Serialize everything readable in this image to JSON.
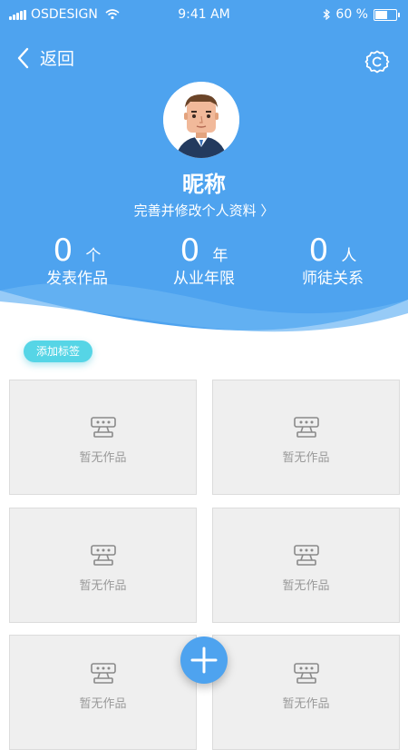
{
  "status_bar": {
    "carrier": "OSDESIGN",
    "time": "9:41 AM",
    "battery": "60 %",
    "battery_level": 0.6
  },
  "nav": {
    "back_label": "返回"
  },
  "profile": {
    "nickname": "昵称",
    "edit_link": "完善并修改个人资料 〉"
  },
  "stats": [
    {
      "value": "0",
      "unit": "个",
      "label": "发表作品"
    },
    {
      "value": "0",
      "unit": "年",
      "label": "从业年限"
    },
    {
      "value": "0",
      "unit": "人",
      "label": "师徒关系"
    }
  ],
  "tag_button": "添加标签",
  "works": [
    {
      "label": "暂无作品"
    },
    {
      "label": "暂无作品"
    },
    {
      "label": "暂无作品"
    },
    {
      "label": "暂无作品"
    },
    {
      "label": "暂无作品"
    },
    {
      "label": "暂无作品"
    }
  ],
  "colors": {
    "header": "#4ea3ef",
    "tag": "#56d5e6",
    "card": "#efefef"
  },
  "icons": [
    "signal-icon",
    "wifi-icon",
    "bluetooth-icon",
    "battery-icon",
    "back-icon",
    "settings-icon",
    "placeholder-icon",
    "plus-icon"
  ]
}
